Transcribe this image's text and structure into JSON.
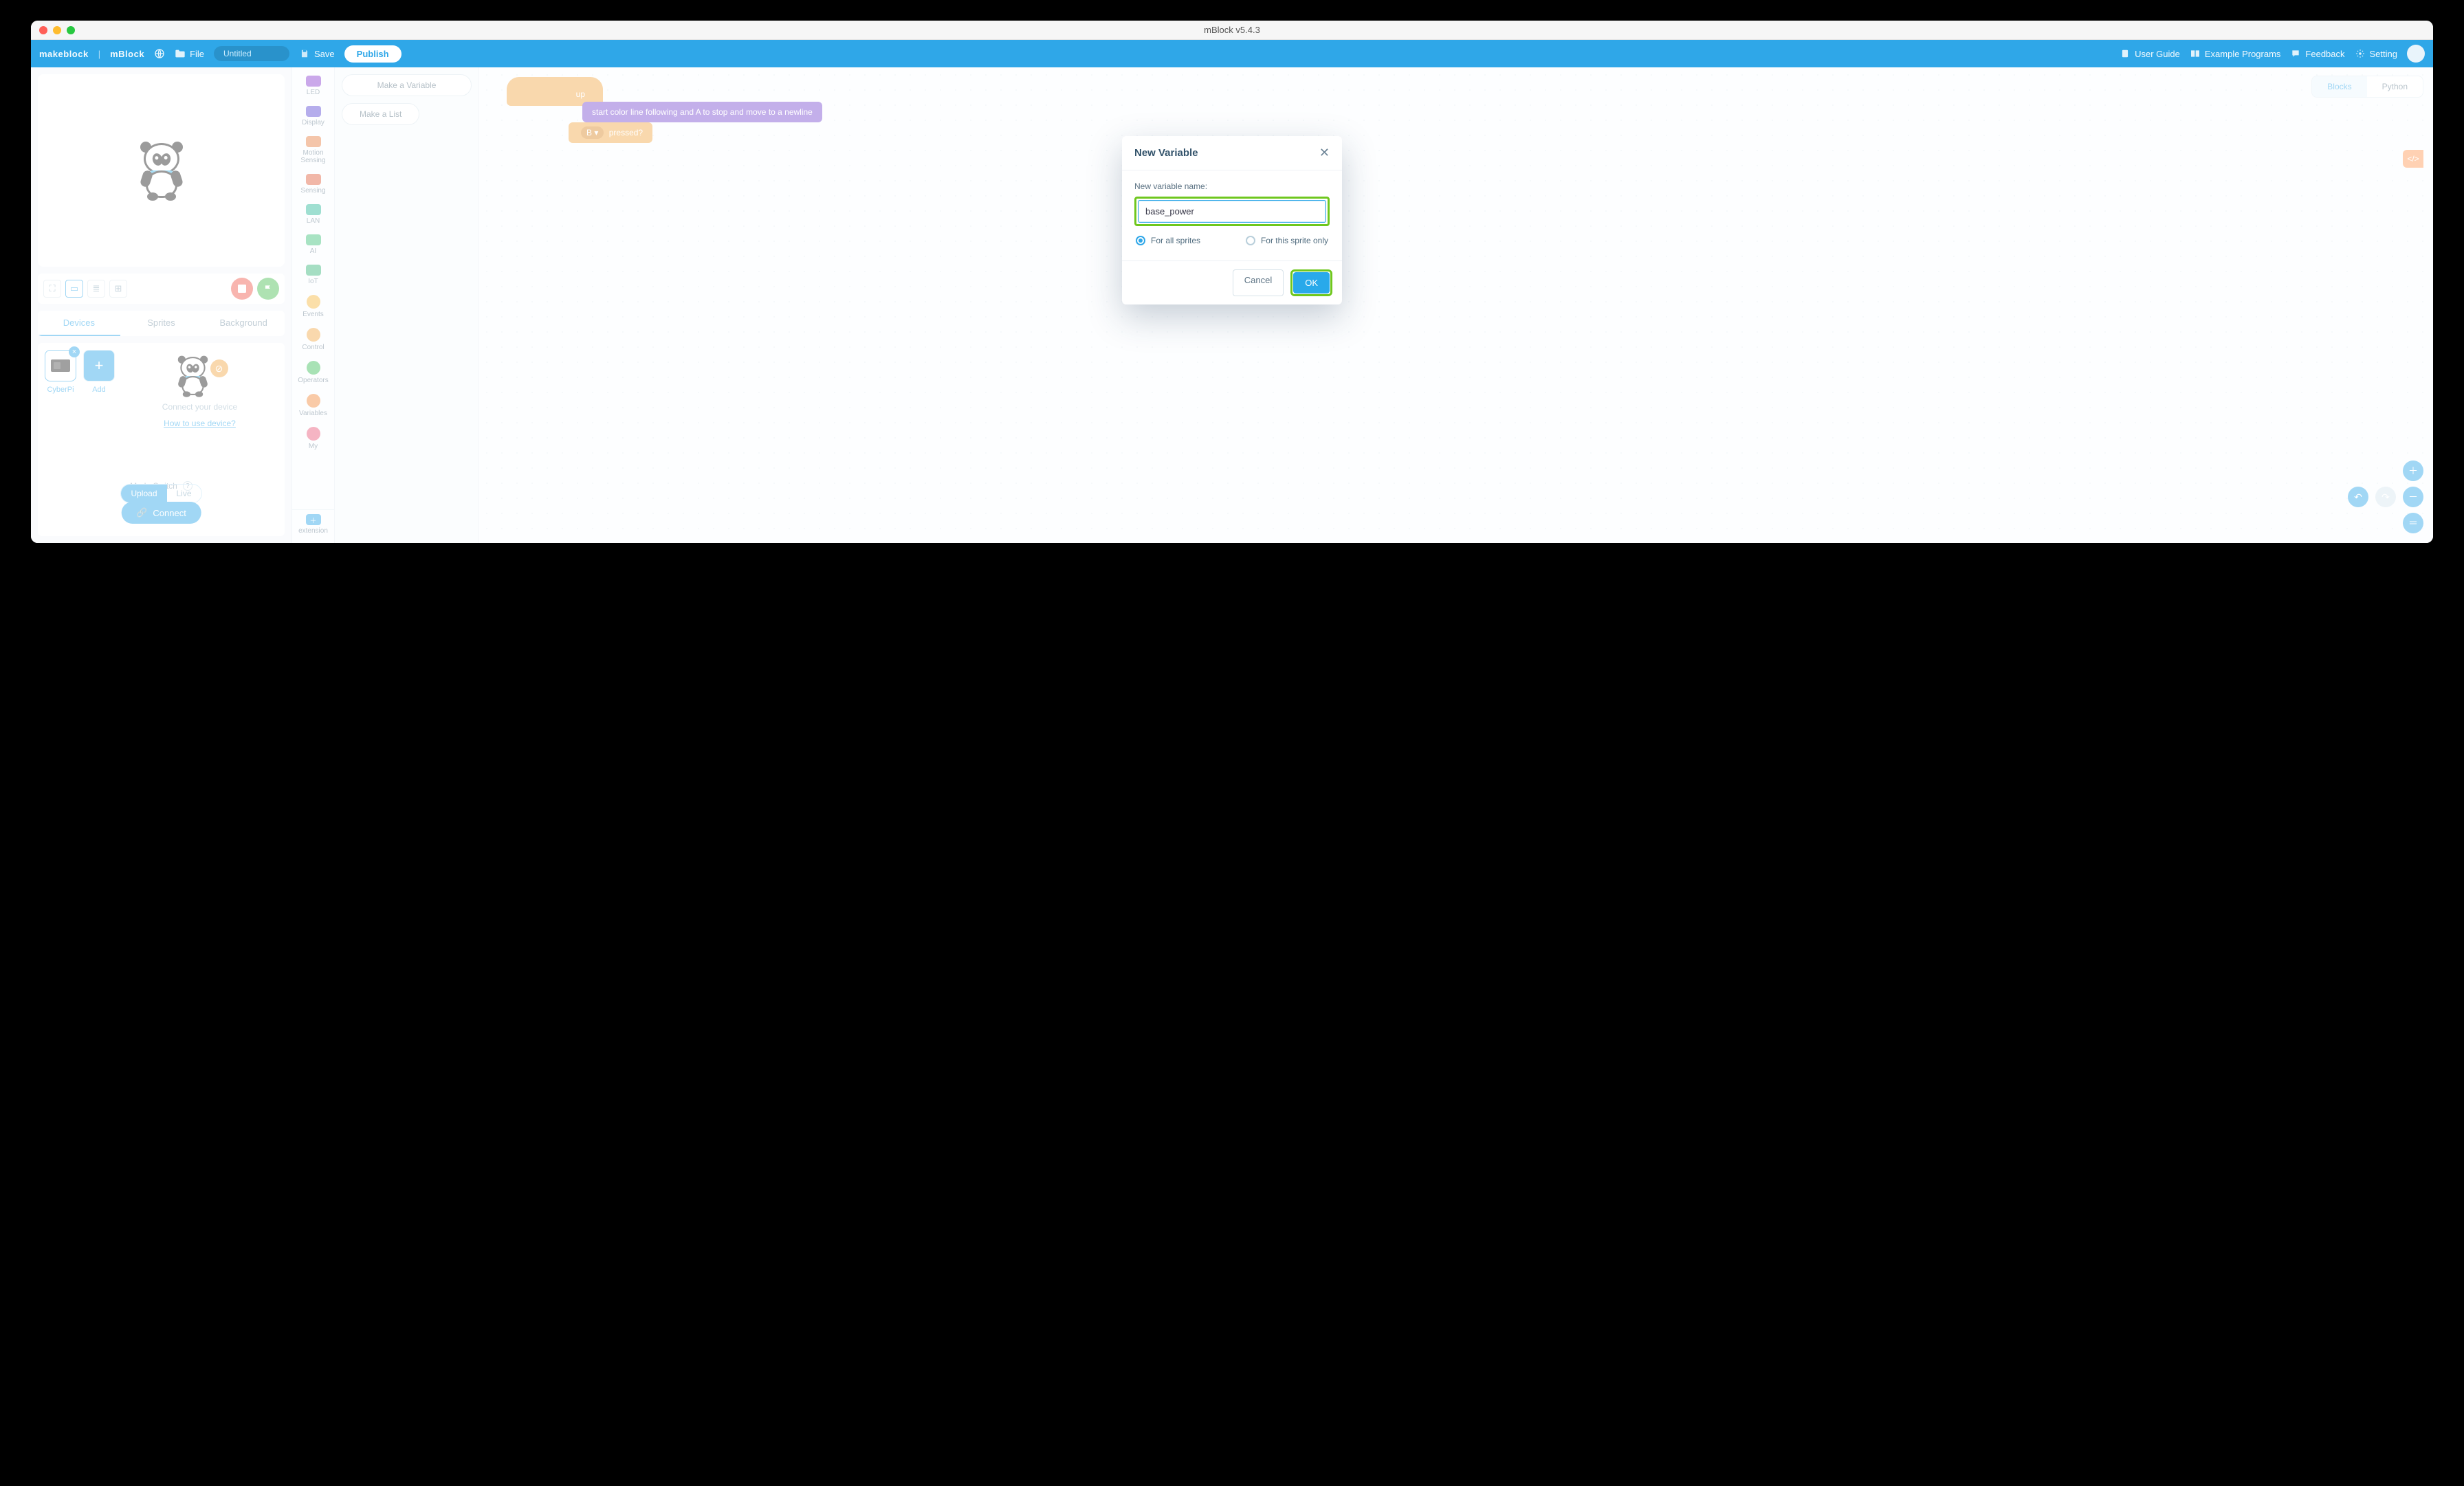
{
  "window": {
    "title": "mBlock v5.4.3"
  },
  "menubar": {
    "brand_left": "makeblock",
    "brand_right": "mBlock",
    "file": "File",
    "filename": "Untitled",
    "save": "Save",
    "publish": "Publish",
    "user_guide": "User Guide",
    "example": "Example Programs",
    "feedback": "Feedback",
    "setting": "Setting"
  },
  "stage_tabs": {
    "devices": "Devices",
    "sprites": "Sprites",
    "background": "Background"
  },
  "devices": {
    "chip": "CyberPi",
    "add": "Add",
    "connect_hint": "Connect your device",
    "howto": "How to use device?",
    "mode_label": "Mode Switch",
    "mode_upload": "Upload",
    "mode_live": "Live",
    "connect": "Connect"
  },
  "categories": {
    "led": "LED",
    "display": "Display",
    "motion": "Motion Sensing",
    "sensing": "Sensing",
    "lan": "LAN",
    "ai": "AI",
    "iot": "IoT",
    "events": "Events",
    "control": "Control",
    "operators": "Operators",
    "variables": "Variables",
    "my": "My",
    "extension": "extension"
  },
  "palette": {
    "make_variable": "Make a Variable",
    "make_list": "Make a List"
  },
  "workspace": {
    "blocks_tab": "Blocks",
    "python_tab": "Python",
    "hat": "up",
    "purple": "start color line following and A to stop   and move to a newline",
    "orange_pre": "",
    "orange_drop": "B ▾",
    "orange_post": "pressed?",
    "code_pill": "</>"
  },
  "dialog": {
    "title": "New Variable",
    "field_label": "New variable name:",
    "value": "base_power",
    "opt_all": "For all sprites",
    "opt_this": "For this sprite only",
    "cancel": "Cancel",
    "ok": "OK"
  }
}
